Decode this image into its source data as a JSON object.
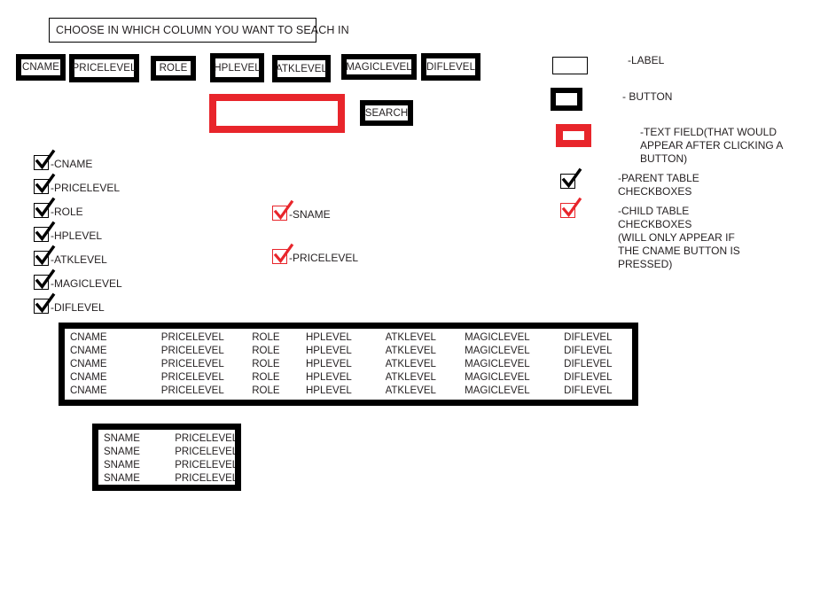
{
  "colors": {
    "accent_red": "#e8252b",
    "ink": "#231f20",
    "frame": "#000000",
    "background": "#ffffff"
  },
  "header": {
    "instruction_label": "CHOOSE IN WHICH COLUMN YOU WANT TO SEACH IN"
  },
  "column_buttons": [
    {
      "label": "CNAME"
    },
    {
      "label": "PRICELEVEL"
    },
    {
      "label": "ROLE"
    },
    {
      "label": "HPLEVEL"
    },
    {
      "label": "ATKLEVEL"
    },
    {
      "label": "MAGICLEVEL"
    },
    {
      "label": "DIFLEVEL"
    }
  ],
  "search": {
    "input_value": "",
    "placeholder": "",
    "button_label": "SEARCH"
  },
  "parent_checkboxes": [
    {
      "label": "-CNAME",
      "checked": true
    },
    {
      "label": "-PRICELEVEL",
      "checked": true
    },
    {
      "label": "-ROLE",
      "checked": true
    },
    {
      "label": "-HPLEVEL",
      "checked": true
    },
    {
      "label": "-ATKLEVEL",
      "checked": true
    },
    {
      "label": "-MAGICLEVEL",
      "checked": true
    },
    {
      "label": "-DIFLEVEL",
      "checked": true
    }
  ],
  "child_checkboxes": [
    {
      "label": "-SNAME",
      "checked": true
    },
    {
      "label": "-PRICELEVEL",
      "checked": true
    }
  ],
  "legend": [
    {
      "swatch": "label-swatch",
      "text": "-LABEL"
    },
    {
      "swatch": "button-swatch",
      "text": "- BUTTON"
    },
    {
      "swatch": "textfield-swatch",
      "text": "-TEXT FIELD(THAT WOULD\nAPPEAR AFTER CLICKING A\nBUTTON)"
    },
    {
      "swatch": "parent-checkbox-swatch",
      "text": "-PARENT TABLE\nCHECKBOXES"
    },
    {
      "swatch": "child-checkbox-swatch",
      "text": "-CHILD TABLE\nCHECKBOXES\n (WILL ONLY APPEAR IF\n THE CNAME BUTTON IS\n PRESSED)"
    }
  ],
  "parent_table": {
    "columns": [
      "CNAME",
      "PRICELEVEL",
      "ROLE",
      "HPLEVEL",
      "ATKLEVEL",
      "MAGICLEVEL",
      "DIFLEVEL"
    ],
    "rows": [
      [
        "CNAME",
        "PRICELEVEL",
        "ROLE",
        "HPLEVEL",
        "ATKLEVEL",
        "MAGICLEVEL",
        "DIFLEVEL"
      ],
      [
        "CNAME",
        "PRICELEVEL",
        "ROLE",
        "HPLEVEL",
        "ATKLEVEL",
        "MAGICLEVEL",
        "DIFLEVEL"
      ],
      [
        "CNAME",
        "PRICELEVEL",
        "ROLE",
        "HPLEVEL",
        "ATKLEVEL",
        "MAGICLEVEL",
        "DIFLEVEL"
      ],
      [
        "CNAME",
        "PRICELEVEL",
        "ROLE",
        "HPLEVEL",
        "ATKLEVEL",
        "MAGICLEVEL",
        "DIFLEVEL"
      ],
      [
        "CNAME",
        "PRICELEVEL",
        "ROLE",
        "HPLEVEL",
        "ATKLEVEL",
        "MAGICLEVEL",
        "DIFLEVEL"
      ]
    ]
  },
  "child_table": {
    "columns": [
      "SNAME",
      "PRICELEVEL"
    ],
    "rows": [
      [
        "SNAME",
        "PRICELEVEL"
      ],
      [
        "SNAME",
        "PRICELEVEL"
      ],
      [
        "SNAME",
        "PRICELEVEL"
      ],
      [
        "SNAME",
        "PRICELEVEL"
      ]
    ]
  }
}
